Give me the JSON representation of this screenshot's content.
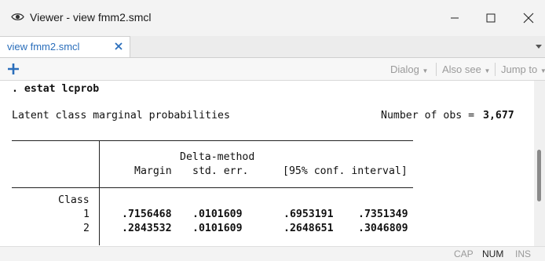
{
  "window": {
    "title": "Viewer - view fmm2.smcl"
  },
  "tabs": [
    {
      "label": "view fmm2.smcl"
    }
  ],
  "toolbar": {
    "dialog_label": "Dialog",
    "also_see_label": "Also see",
    "jump_to_label": "Jump to"
  },
  "output": {
    "command": ". estat lcprob",
    "heading": "Latent class marginal probabilities",
    "obs_label": "Number of obs =",
    "obs_value": "3,677",
    "header_delta": "Delta-method",
    "col_margin": "Margin",
    "col_stderr": "std. err.",
    "col_ci": "[95% conf. interval]",
    "row_group": "Class",
    "rows": [
      {
        "label": "1",
        "margin": ".7156468",
        "stderr": ".0101609",
        "ci_low": ".6953191",
        "ci_high": ".7351349"
      },
      {
        "label": "2",
        "margin": ".2843532",
        "stderr": ".0101609",
        "ci_low": ".2648651",
        "ci_high": ".3046809"
      }
    ]
  },
  "statusbar": {
    "cap": "CAP",
    "num": "NUM",
    "ins": "INS"
  },
  "colors": {
    "accent": "#2a6ebb",
    "disabled": "#9a9a9a"
  }
}
